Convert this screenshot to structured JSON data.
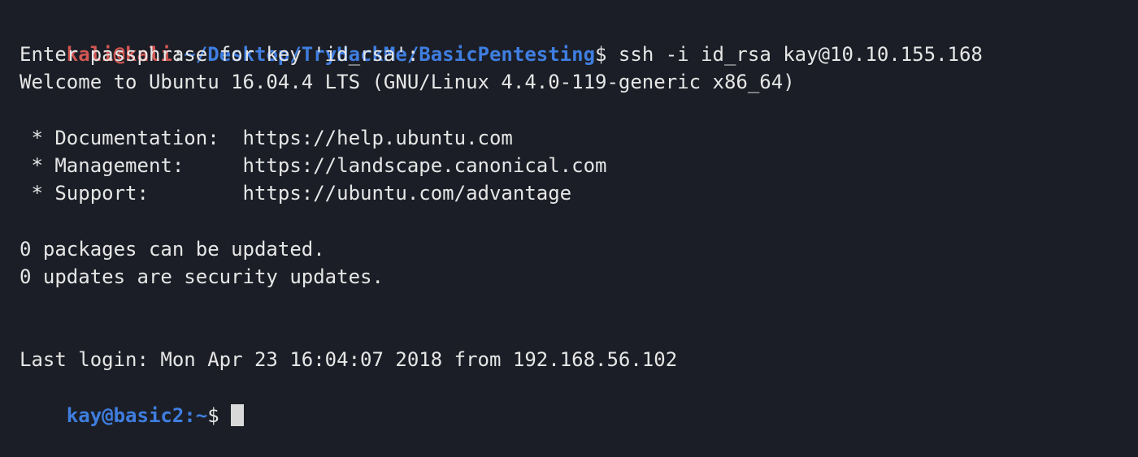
{
  "colors": {
    "background": "#1b1e26",
    "text": "#e6e6e6",
    "prompt_user": "#d25752",
    "prompt_path": "#3f7ee0",
    "prompt_remote": "#3f7ee0",
    "cursor": "#d9d9d9"
  },
  "prompt_local": {
    "user_host": "kali@kali",
    "separator": ":",
    "path": "~/Desktop/TryHackMe/BasicPentesting",
    "symbol": "$",
    "command": " ssh -i id_rsa kay@10.10.155.168"
  },
  "output": {
    "passphrase": "Enter passphrase for key 'id_rsa':",
    "welcome": "Welcome to Ubuntu 16.04.4 LTS (GNU/Linux 4.4.0-119-generic x86_64)",
    "doc_line": " * Documentation:  https://help.ubuntu.com",
    "mgmt_line": " * Management:     https://landscape.canonical.com",
    "support_line": " * Support:        https://ubuntu.com/advantage",
    "packages_line": "0 packages can be updated.",
    "security_line": "0 updates are security updates.",
    "last_login": "Last login: Mon Apr 23 16:04:07 2018 from 192.168.56.102"
  },
  "prompt_remote": {
    "user_host_path": "kay@basic2:~",
    "symbol": "$"
  }
}
